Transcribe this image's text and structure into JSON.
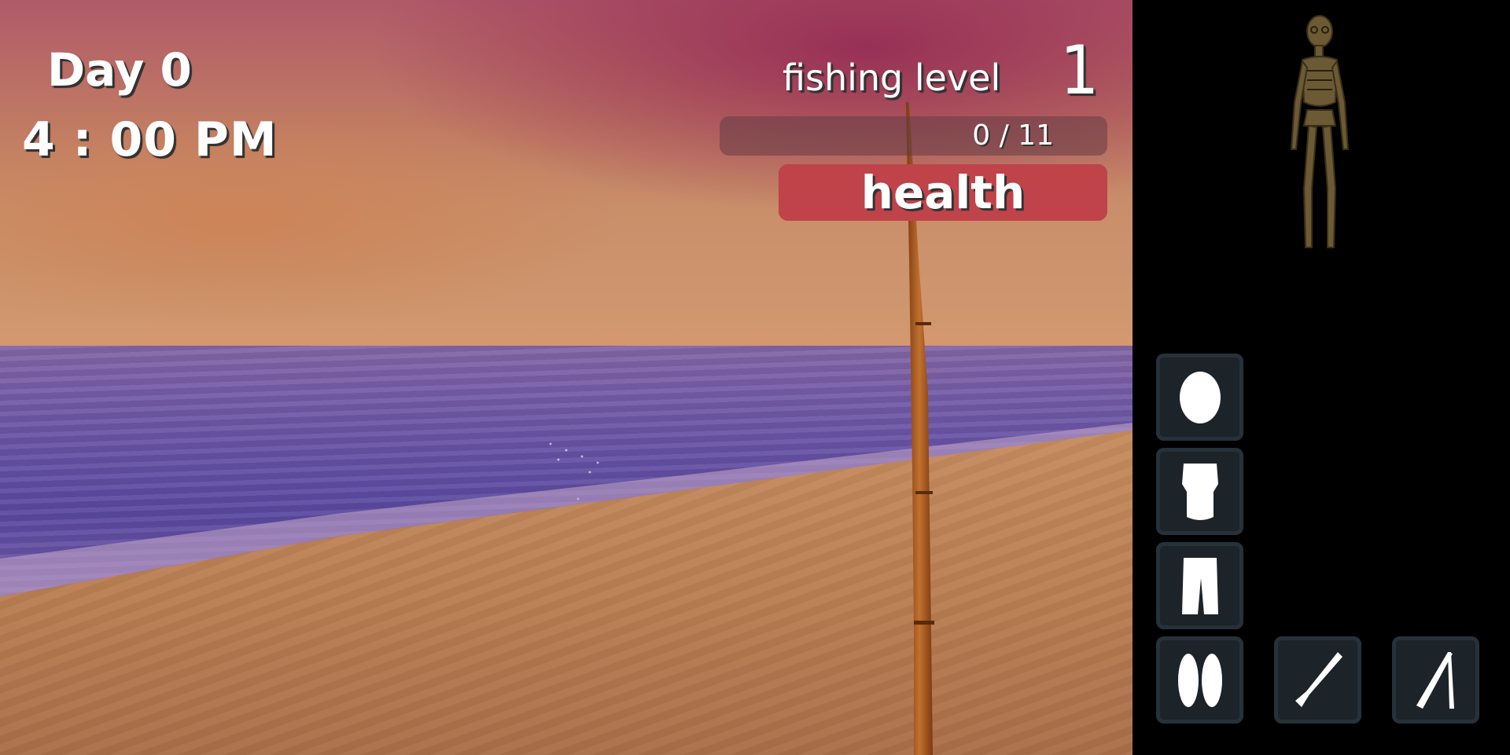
{
  "hud": {
    "day": "Day 0",
    "time": "4 : 00 PM",
    "fishing_label": "fishing level",
    "fishing_level": "1",
    "fishing_xp": "0 / 11",
    "fishing_xp_fraction": 0,
    "health_label": "health",
    "health_fraction": 1.0
  },
  "inventory": {
    "slots": [
      {
        "icon": "head-slot-icon"
      },
      {
        "icon": "torso-slot-icon"
      },
      {
        "icon": "legs-slot-icon"
      },
      {
        "icon": "feet-slot-icon"
      },
      {
        "icon": "knife-slot-icon"
      },
      {
        "icon": "fishing-rod-slot-icon"
      }
    ]
  },
  "colors": {
    "health": "#bf4349",
    "xp_track": "#64404a",
    "slot_bg": "#1c2329"
  }
}
